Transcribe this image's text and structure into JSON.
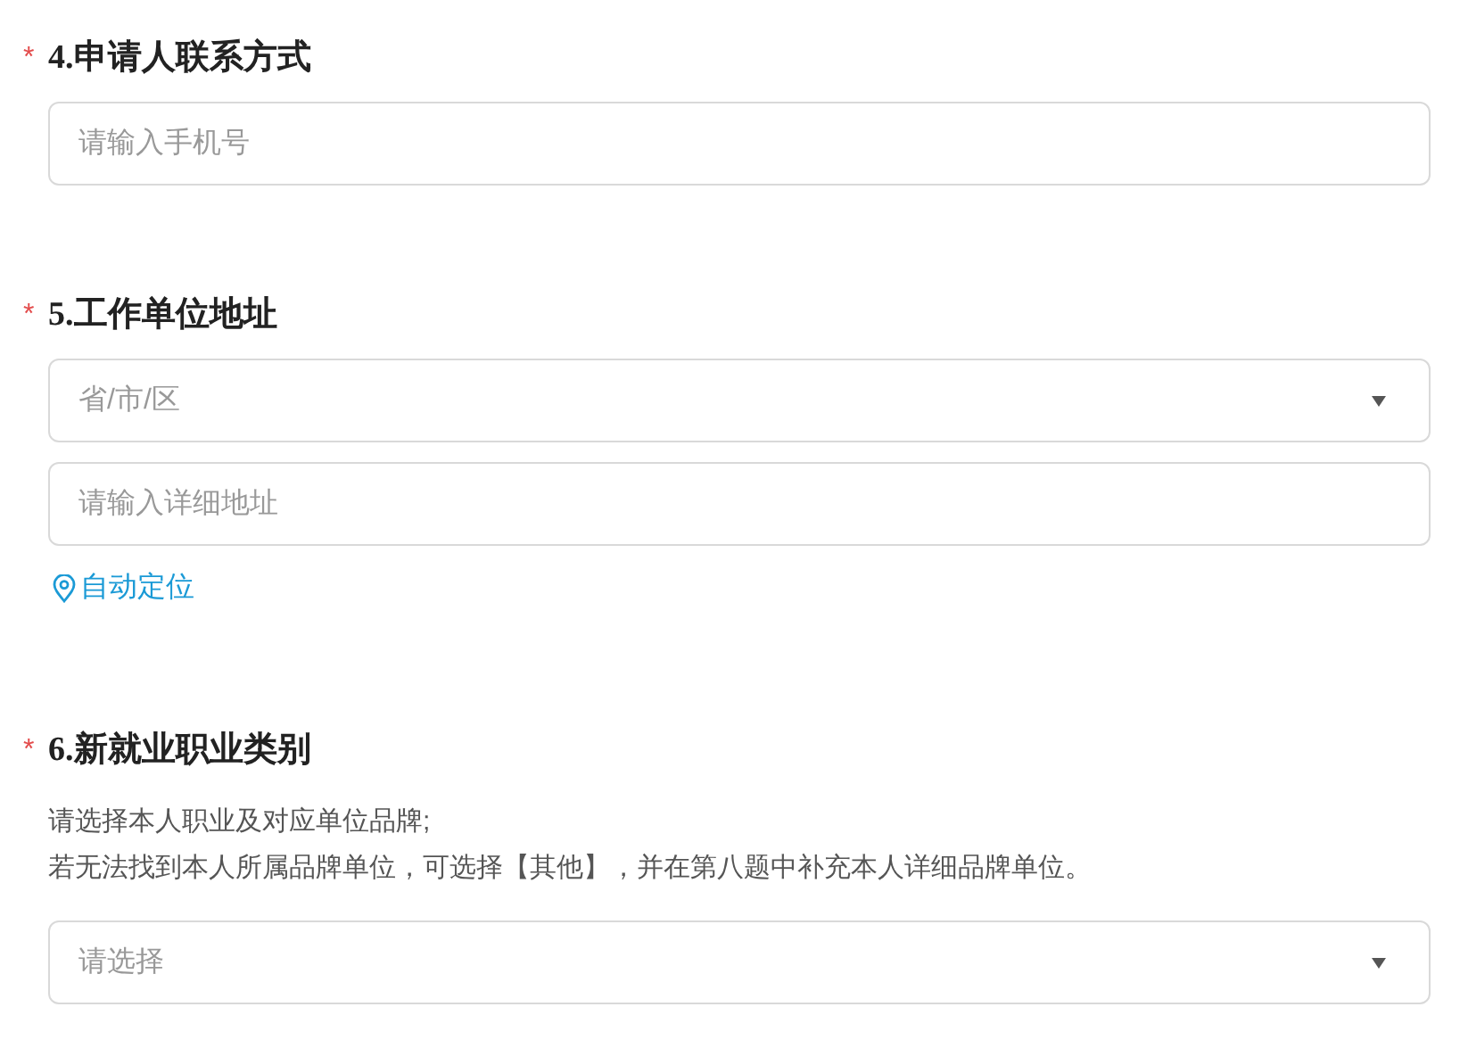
{
  "questions": [
    {
      "required_mark": "*",
      "number": "4.",
      "title": "申请人联系方式",
      "fields": [
        {
          "kind": "input",
          "placeholder": "请输入手机号"
        }
      ]
    },
    {
      "required_mark": "*",
      "number": "5.",
      "title": "工作单位地址",
      "fields": [
        {
          "kind": "select",
          "placeholder": "省/市/区"
        },
        {
          "kind": "input",
          "placeholder": "请输入详细地址"
        }
      ],
      "link": "自动定位"
    },
    {
      "required_mark": "*",
      "number": "6.",
      "title": "新就业职业类别",
      "description": [
        "请选择本人职业及对应单位品牌;",
        "若无法找到本人所属品牌单位，可选择【其他】，并在第八题中补充本人详细品牌单位。"
      ],
      "fields": [
        {
          "kind": "select",
          "placeholder": "请选择"
        }
      ]
    }
  ]
}
